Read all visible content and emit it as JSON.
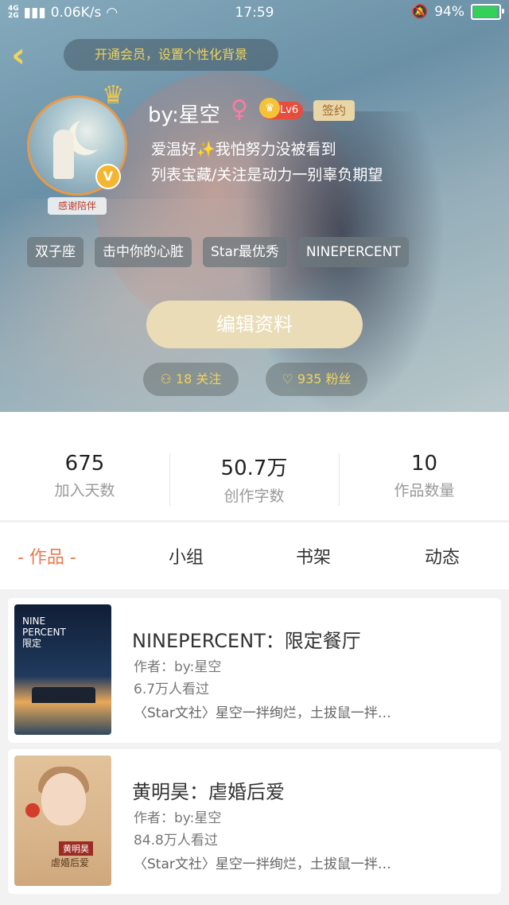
{
  "status_bar": {
    "network": "4G\n2G",
    "speed": "0.06K/s",
    "time": "17:59",
    "battery": "94%",
    "battery_color": "#34d058"
  },
  "header": {
    "back_icon": "chevron-left-icon",
    "vip_banner": "开通会员，设置个性化背景"
  },
  "profile": {
    "avatar_badge": "V",
    "thanks_badge": "感谢陪伴",
    "nickname": "by:星空",
    "gender": "♀",
    "level": "Lv6",
    "signed": "签约",
    "bio_line1": "爱温好✨我怕努力没被看到",
    "bio_line2": "列表宝藏/关注是动力一别辜负期望",
    "tags": [
      "双子座",
      "击中你的心脏",
      "Star最优秀",
      "NINEPERCENT"
    ],
    "edit_button": "编辑资料",
    "follow_text": "18 关注",
    "fans_text": "935 粉丝"
  },
  "stats": [
    {
      "value": "675",
      "label": "加入天数"
    },
    {
      "value": "50.7万",
      "label": "创作字数"
    },
    {
      "value": "10",
      "label": "作品数量"
    }
  ],
  "tabs": [
    {
      "label": "- 作品 -",
      "active": true
    },
    {
      "label": "小组",
      "active": false
    },
    {
      "label": "书架",
      "active": false
    },
    {
      "label": "动态",
      "active": false
    }
  ],
  "accent_color": "#e9794f",
  "works": [
    {
      "title": "NINEPERCENT：限定餐厅",
      "author": "作者：by:星空",
      "views": "6.7万人看过",
      "desc": "〈Star文社〉星空一拌绚烂，土拔鼠一拌…",
      "cover_text": "NINE\nPERCENT\n限定"
    },
    {
      "title": "黄明昊：虐婚后爱",
      "author": "作者：by:星空",
      "views": "84.8万人看过",
      "desc": "〈Star文社〉星空一拌绚烂，土拔鼠一拌…",
      "cover_name": "黄明昊",
      "cover_sub": "虐婚后爱"
    }
  ]
}
